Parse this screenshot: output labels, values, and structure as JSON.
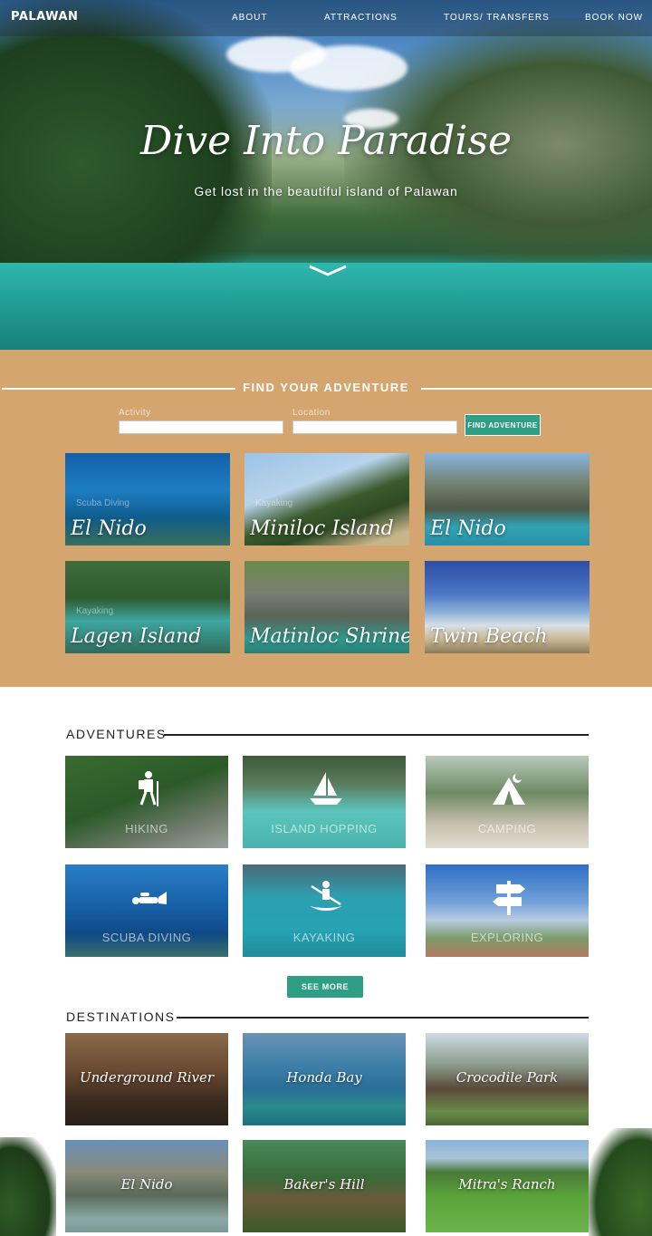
{
  "nav": {
    "logo": "PALAWAN",
    "items": [
      "ABOUT",
      "ATTRACTIONS",
      "TOURS/ TRANSFERS",
      "BOOK NOW"
    ]
  },
  "hero": {
    "title": "Dive Into Paradise",
    "subtitle": "Get lost in the beautiful island of Palawan",
    "scroll_icon": "chevron-down-icon"
  },
  "find": {
    "title": "FIND YOUR ADVENTURE",
    "activity_label": "Activity",
    "location_label": "Location",
    "activity_value": "",
    "location_value": "",
    "button": "FIND ADVENTURE",
    "tiles": [
      {
        "activity": "Scuba Diving",
        "place": "El Nido"
      },
      {
        "activity": "Kayaking",
        "place": "Miniloc Island"
      },
      {
        "activity": "",
        "place": "El Nido"
      },
      {
        "activity": "Kayaking",
        "place": "Lagen Island"
      },
      {
        "activity": "",
        "place": "Matinloc Shrine"
      },
      {
        "activity": "",
        "place": "Twin Beach"
      }
    ]
  },
  "adventures": {
    "title": "ADVENTURES",
    "items": [
      {
        "label": "HIKING",
        "icon": "hiker-icon"
      },
      {
        "label": "ISLAND HOPPING",
        "icon": "sailboat-icon"
      },
      {
        "label": "CAMPING",
        "icon": "tent-icon"
      },
      {
        "label": "SCUBA DIVING",
        "icon": "diver-icon"
      },
      {
        "label": "KAYAKING",
        "icon": "kayak-icon"
      },
      {
        "label": "EXPLORING",
        "icon": "signpost-icon"
      }
    ],
    "see_more": "SEE MORE"
  },
  "destinations": {
    "title": "DESTINATIONS",
    "items": [
      "Underground River",
      "Honda Bay",
      "Crocodile Park",
      "El Nido",
      "Baker's Hill",
      "Mitra's Ranch"
    ]
  },
  "colors": {
    "accent": "#2e9e84",
    "tan": "#d4a56f"
  }
}
